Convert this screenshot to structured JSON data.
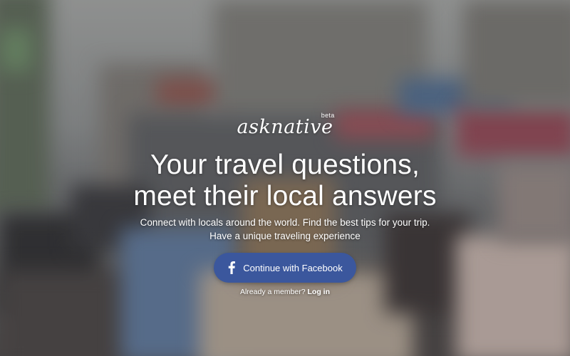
{
  "brand": {
    "logo_text": "asknative",
    "badge": "beta"
  },
  "hero": {
    "headline_line1": "Your travel questions,",
    "headline_line2": "meet their local answers",
    "subtext": "Connect with locals around the world. Find the best tips for your trip. Have a unique traveling experience"
  },
  "cta": {
    "facebook_label": "Continue with Facebook",
    "facebook_icon": "facebook-icon",
    "button_color": "#3b579d"
  },
  "footer": {
    "member_prompt": "Already a member?",
    "login_label": "Log in"
  }
}
